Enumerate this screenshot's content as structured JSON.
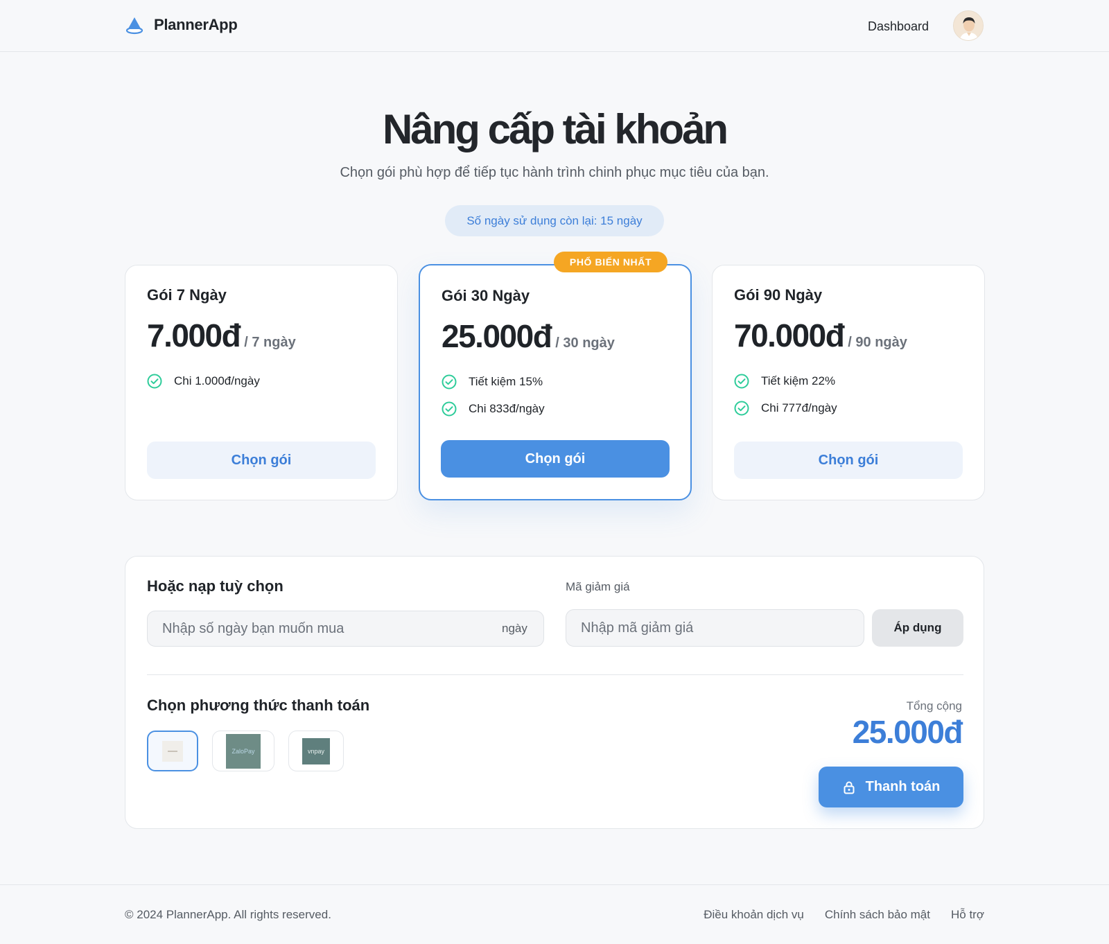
{
  "header": {
    "app_name": "PlannerApp",
    "nav_dashboard": "Dashboard",
    "brand_color": "#4a90e2"
  },
  "hero": {
    "title": "Nâng cấp tài khoản",
    "subtitle": "Chọn gói phù hợp để tiếp tục hành trình chinh phục mục tiêu của bạn.",
    "days_remaining": "Số ngày sử dụng còn lại: 15 ngày"
  },
  "plans": [
    {
      "name": "Gói 7 Ngày",
      "price": "7.000đ",
      "period": "/ 7 ngày",
      "features": [
        "Chi 1.000đ/ngày"
      ],
      "button": "Chọn gói"
    },
    {
      "name": "Gói 30 Ngày",
      "price": "25.000đ",
      "period": "/ 30 ngày",
      "badge": "PHỔ BIẾN NHẤT",
      "features": [
        "Tiết kiệm 15%",
        "Chi 833đ/ngày"
      ],
      "button": "Chọn gói"
    },
    {
      "name": "Gói 90 Ngày",
      "price": "70.000đ",
      "period": "/ 90 ngày",
      "features": [
        "Tiết kiệm 22%",
        "Chi 777đ/ngày"
      ],
      "button": "Chọn gói"
    }
  ],
  "custom": {
    "title": "Hoặc nạp tuỳ chọn",
    "days_placeholder": "Nhập số ngày bạn muốn mua",
    "days_suffix": "ngày",
    "coupon_label": "Mã giảm giá",
    "coupon_placeholder": "Nhập mã giảm giá",
    "apply_button": "Áp dụng"
  },
  "payment": {
    "title": "Chọn phương thức thanh toán",
    "methods": [
      {
        "icon": "momo-logo",
        "selected": true
      },
      {
        "label": "ZaloPay",
        "icon": "zalopay-logo",
        "selected": false
      },
      {
        "label": "vnpay",
        "icon": "vnpay-logo",
        "selected": false
      }
    ],
    "total_label": "Tổng cộng",
    "total_value": "25.000đ",
    "pay_button": "Thanh toán"
  },
  "footer": {
    "copyright": "© 2024 PlannerApp. All rights reserved.",
    "links": [
      "Điều khoản dịch vụ",
      "Chính sách bảo mật",
      "Hỗ trợ"
    ]
  }
}
